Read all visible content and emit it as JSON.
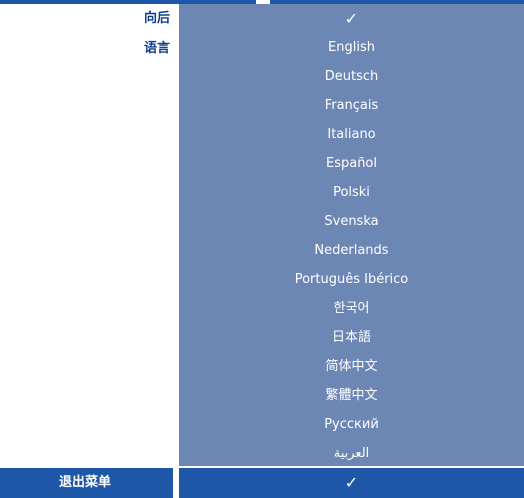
{
  "menu": {
    "back_label": "向后",
    "language_label": "语言",
    "back_check": "✓",
    "languages": [
      "English",
      "Deutsch",
      "Français",
      "Italiano",
      "Español",
      "Polski",
      "Svenska",
      "Nederlands",
      "Português Ibérico",
      "한국어",
      "日本語",
      "简体中文",
      "繁體中文",
      "Русский",
      "العربية"
    ],
    "exit_label": "退出菜单",
    "exit_check": "✓"
  },
  "colors": {
    "accent": "#1e56a8",
    "panel": "#6d87b5",
    "label_text": "#0f3f8c"
  }
}
